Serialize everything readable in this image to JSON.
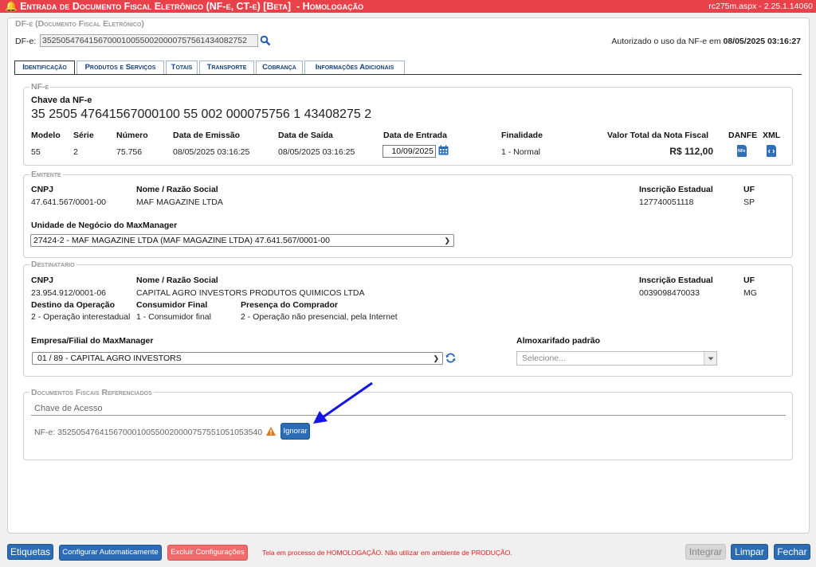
{
  "window": {
    "title": "Entrada de Documento Fiscal Eletrônico (NF-e, CT-e) [Beta]",
    "env": "- Homologação",
    "version": "rc275m.aspx - 2.25.1.14060"
  },
  "header": {
    "section_title": "DF-e (Documento Fiscal Eletrônico)",
    "dfe_label": "DF-e:",
    "dfe_value": "35250547641567000100550020000757561434082752",
    "status_text": "Autorizado o uso da NF-e em",
    "status_date": "08/05/2025 03:16:27"
  },
  "tabs": [
    {
      "label": "Identificação",
      "active": true
    },
    {
      "label": "Produtos e Serviços"
    },
    {
      "label": "Totais"
    },
    {
      "label": "Transporte"
    },
    {
      "label": "Cobrança"
    },
    {
      "label": "Informações Adicionais"
    }
  ],
  "nfe": {
    "section_title": "NF-e",
    "chave_label": "Chave da NF-e",
    "chave_value": "35 2505 47641567000100 55 002 000075756 1 43408275 2",
    "labels": {
      "modelo": "Modelo",
      "serie": "Série",
      "numero": "Número",
      "emissao": "Data de Emissão",
      "saida": "Data de Saída",
      "entrada": "Data de Entrada",
      "finalidade": "Finalidade",
      "valor": "Valor Total da Nota Fiscal",
      "danfe": "DANFE",
      "xml": "XML"
    },
    "values": {
      "modelo": "55",
      "serie": "2",
      "numero": "75.756",
      "emissao": "08/05/2025 03:16:25",
      "saida": "08/05/2025 03:16:25",
      "entrada": "10/09/2025",
      "finalidade": "1 - Normal",
      "valor": "R$ 112,00"
    },
    "danfe_icon_text": "NFe"
  },
  "emitente": {
    "section_title": "Emitente",
    "labels": {
      "cnpj": "CNPJ",
      "nome": "Nome / Razão Social",
      "ie": "Inscrição Estadual",
      "uf": "UF"
    },
    "values": {
      "cnpj": "47.641.567/0001-00",
      "nome": "MAF MAGAZINE LTDA",
      "ie": "127740051118",
      "uf": "SP"
    },
    "unidade_label": "Unidade de Negócio do MaxManager",
    "unidade_value": "27424-2 - MAF MAGAZINE LTDA (MAF MAGAZINE LTDA) 47.641.567/0001-00"
  },
  "destinatario": {
    "section_title": "Destinatário",
    "labels": {
      "cnpj": "CNPJ",
      "nome": "Nome / Razão Social",
      "ie": "Inscrição Estadual",
      "uf": "UF",
      "destino": "Destino da Operação",
      "consumidor": "Consumidor Final",
      "presenca": "Presença do Comprador"
    },
    "values": {
      "cnpj": "23.954.912/0001-06",
      "nome": "CAPITAL AGRO INVESTORS PRODUTOS QUIMICOS LTDA",
      "ie": "0039098470033",
      "uf": "MG",
      "destino": "2 - Operação interestadual",
      "consumidor": "1 - Consumidor final",
      "presenca": "2 - Operação não presencial, pela Internet"
    },
    "empresa_label": "Empresa/Filial do MaxManager",
    "empresa_value": "01 / 89 - CAPITAL AGRO INVESTORS",
    "almox_label": "Almoxarifado padrão",
    "almox_placeholder": "Selecione..."
  },
  "referenciados": {
    "section_title": "Documentos Fiscais Referenciados",
    "col_header": "Chave de Acesso",
    "rows": [
      {
        "text": "NF-e: 35250547641567000100550020000757551051053540",
        "button": "Ignorar"
      }
    ]
  },
  "footer": {
    "etiquetas": "Etiquetas",
    "configurar": "Configurar Automaticamente",
    "excluir": "Excluir Configurações",
    "warning": "Tela em processo de HOMOLOGAÇÃO. Não utilizar em ambiente de PRODUÇÃO.",
    "integrar": "Integrar",
    "limpar": "Limpar",
    "fechar": "Fechar"
  },
  "colors": {
    "titlebar": "#e8414a",
    "primary_button": "#2b6cb5",
    "danger_button": "#f06b6b",
    "warning_icon": "#e0771b",
    "annotation_arrow": "#1414e6"
  }
}
